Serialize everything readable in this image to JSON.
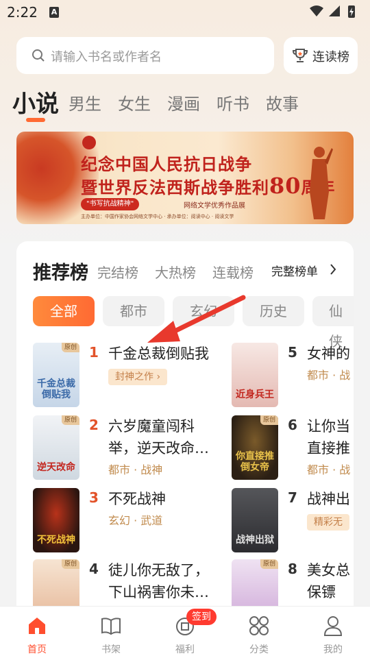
{
  "status": {
    "time": "2:22",
    "app_letter": "A"
  },
  "search": {
    "placeholder": "请输入书名或作者名",
    "rank_label": "连读榜"
  },
  "category_tabs": [
    {
      "label": "小说",
      "active": true
    },
    {
      "label": "男生"
    },
    {
      "label": "女生"
    },
    {
      "label": "漫画"
    },
    {
      "label": "听书"
    },
    {
      "label": "故事"
    }
  ],
  "banner": {
    "line1": "纪念中国人民抗日战争",
    "line2_prefix": "暨世界反法西斯战争胜利",
    "line2_number": "80",
    "line2_suffix": "周年",
    "pill": "\"书写抗战精神\"",
    "pill_tail": "网络文学优秀作品展",
    "sponsor": "主办单位：中国作家协会网络文学中心  ·  承办单位：阅读中心  ·  阅读文学"
  },
  "ranking": {
    "tabs": [
      {
        "label": "推荐榜",
        "active": true
      },
      {
        "label": "完结榜"
      },
      {
        "label": "大热榜"
      },
      {
        "label": "连载榜"
      }
    ],
    "full_list_label": "完整榜单",
    "genres": [
      {
        "label": "全部",
        "active": true
      },
      {
        "label": "都市"
      },
      {
        "label": "玄幻"
      },
      {
        "label": "历史"
      },
      {
        "label": "仙侠"
      }
    ],
    "left_books": [
      {
        "rank": "1",
        "title": "千金总裁倒贴我",
        "tag": "封神之作 ›",
        "cover_text": "千金总裁倒贴我",
        "original": "原创",
        "cover_bg": "#dbe7f2",
        "cover_fg": "#3b6aa8"
      },
      {
        "rank": "2",
        "title": "六岁魔童闯科举，逆天改命…",
        "meta": "都市 · 战神",
        "cover_text": "逆天改命",
        "original": "原创",
        "cover_bg": "#e9eef2",
        "cover_fg": "#c3261e"
      },
      {
        "rank": "3",
        "title": "不死战神",
        "meta": "玄幻 · 武道",
        "cover_text": "不死战神",
        "cover_bg": "#2a1510",
        "cover_fg": "#f2c13a"
      },
      {
        "rank": "4",
        "title": "徒儿你无敌了，下山祸害你未…",
        "meta": "",
        "cover_text": "",
        "original": "原创",
        "cover_bg": "#f3d9c2",
        "cover_fg": "#c2261e"
      }
    ],
    "right_books": [
      {
        "rank": "5",
        "title": "女神的",
        "meta": "都市 · 战",
        "cover_text": "近身兵王",
        "cover_bg": "#f4dcd8",
        "cover_fg": "#c2261e"
      },
      {
        "rank": "6",
        "title": "让你当直接推",
        "meta": "都市 · 战",
        "cover_text": "你直接推倒女帝",
        "original": "原创",
        "cover_bg": "#2b1f14",
        "cover_fg": "#e8c14a"
      },
      {
        "rank": "7",
        "title": "战神出",
        "tag": "精彩无",
        "cover_text": "战神出狱",
        "cover_bg": "#3a3a3e",
        "cover_fg": "#e0e0e0"
      },
      {
        "rank": "8",
        "title": "美女总保镖",
        "meta": "",
        "cover_text": "",
        "original": "原创",
        "cover_bg": "#e7d6ee",
        "cover_fg": "#b0245a"
      }
    ]
  },
  "bottom_nav": [
    {
      "label": "首页",
      "icon": "home-icon",
      "active": true
    },
    {
      "label": "书架",
      "icon": "book-icon"
    },
    {
      "label": "福利",
      "icon": "gift-icon",
      "badge": "签到"
    },
    {
      "label": "分类",
      "icon": "grid-icon"
    },
    {
      "label": "我的",
      "icon": "person-icon"
    }
  ],
  "colors": {
    "accent": "#ff6a33",
    "rank_top": "#e2532a",
    "nav_active": "#ff4e2e",
    "badge": "#ff3b30",
    "annotation_arrow": "#e8392d"
  }
}
